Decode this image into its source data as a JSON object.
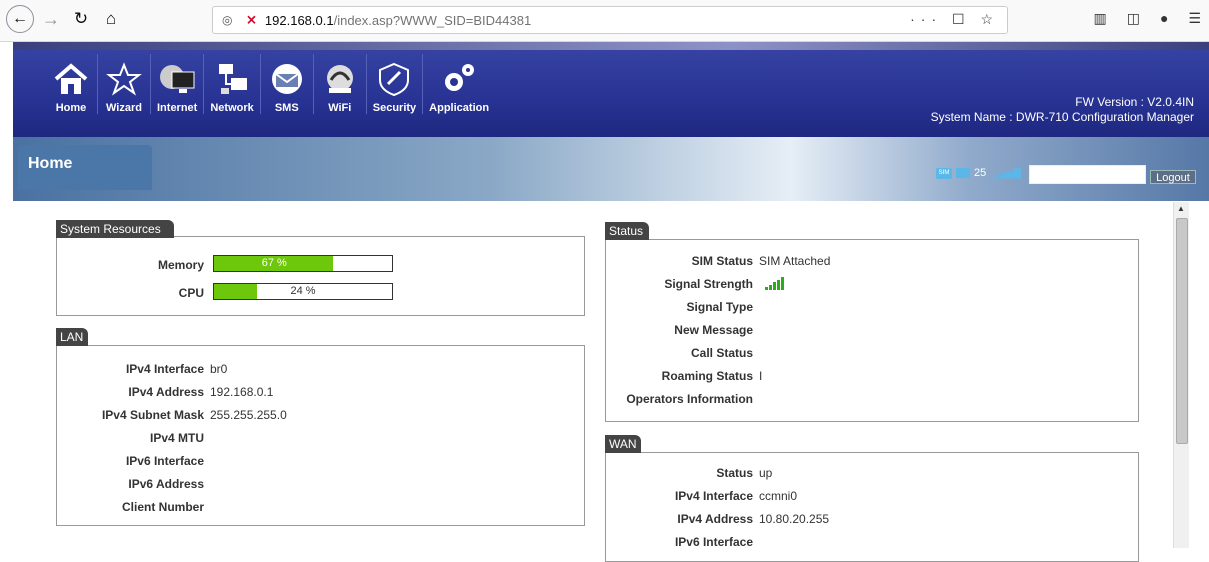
{
  "browser": {
    "url_host": "192.168.0.1",
    "url_path": "/index.asp?WWW_SID=BID44381",
    "url_actions": "··· ☐ ☆"
  },
  "menu": [
    {
      "label": "Home",
      "icon": "home-icon"
    },
    {
      "label": "Wizard",
      "icon": "wizard-icon"
    },
    {
      "label": "Internet",
      "icon": "internet-icon"
    },
    {
      "label": "Network",
      "icon": "network-icon"
    },
    {
      "label": "SMS",
      "icon": "sms-icon"
    },
    {
      "label": "WiFi",
      "icon": "wifi-icon"
    },
    {
      "label": "Security",
      "icon": "security-icon"
    },
    {
      "label": "Application",
      "icon": "application-icon"
    }
  ],
  "header": {
    "fw_version": "FW Version : V2.0.4IN",
    "system_name": "System Name : DWR-710 Configuration Manager"
  },
  "page": {
    "title": "Home",
    "message_count": "25",
    "logout": "Logout"
  },
  "system_resources": {
    "title": "System Resources",
    "memory_label": "Memory",
    "memory_value": "67 %",
    "memory_pct": 67,
    "cpu_label": "CPU",
    "cpu_value": "24 %",
    "cpu_pct": 24
  },
  "lan": {
    "title": "LAN",
    "rows": [
      {
        "label": "IPv4 Interface",
        "value": "br0"
      },
      {
        "label": "IPv4 Address",
        "value": "192.168.0.1"
      },
      {
        "label": "IPv4 Subnet Mask",
        "value": "255.255.255.0"
      },
      {
        "label": "IPv4 MTU",
        "value": ""
      },
      {
        "label": "IPv6 Interface",
        "value": ""
      },
      {
        "label": "IPv6 Address",
        "value": ""
      },
      {
        "label": "Client Number",
        "value": ""
      }
    ]
  },
  "status": {
    "title": "Status",
    "rows": [
      {
        "label": "SIM Status",
        "value": "SIM Attached"
      },
      {
        "label": "Signal Strength",
        "value": ""
      },
      {
        "label": "Signal Type",
        "value": ""
      },
      {
        "label": "New Message",
        "value": ""
      },
      {
        "label": "Call Status",
        "value": ""
      },
      {
        "label": "Roaming Status",
        "value": "I"
      },
      {
        "label": "Operators Information",
        "value": ""
      }
    ],
    "signal_bars": 5
  },
  "wan": {
    "title": "WAN",
    "rows": [
      {
        "label": "Status",
        "value": "up"
      },
      {
        "label": "IPv4 Interface",
        "value": "ccmni0"
      },
      {
        "label": "IPv4 Address",
        "value": "10.80.20.255"
      },
      {
        "label": "IPv6 Interface",
        "value": ""
      }
    ]
  }
}
